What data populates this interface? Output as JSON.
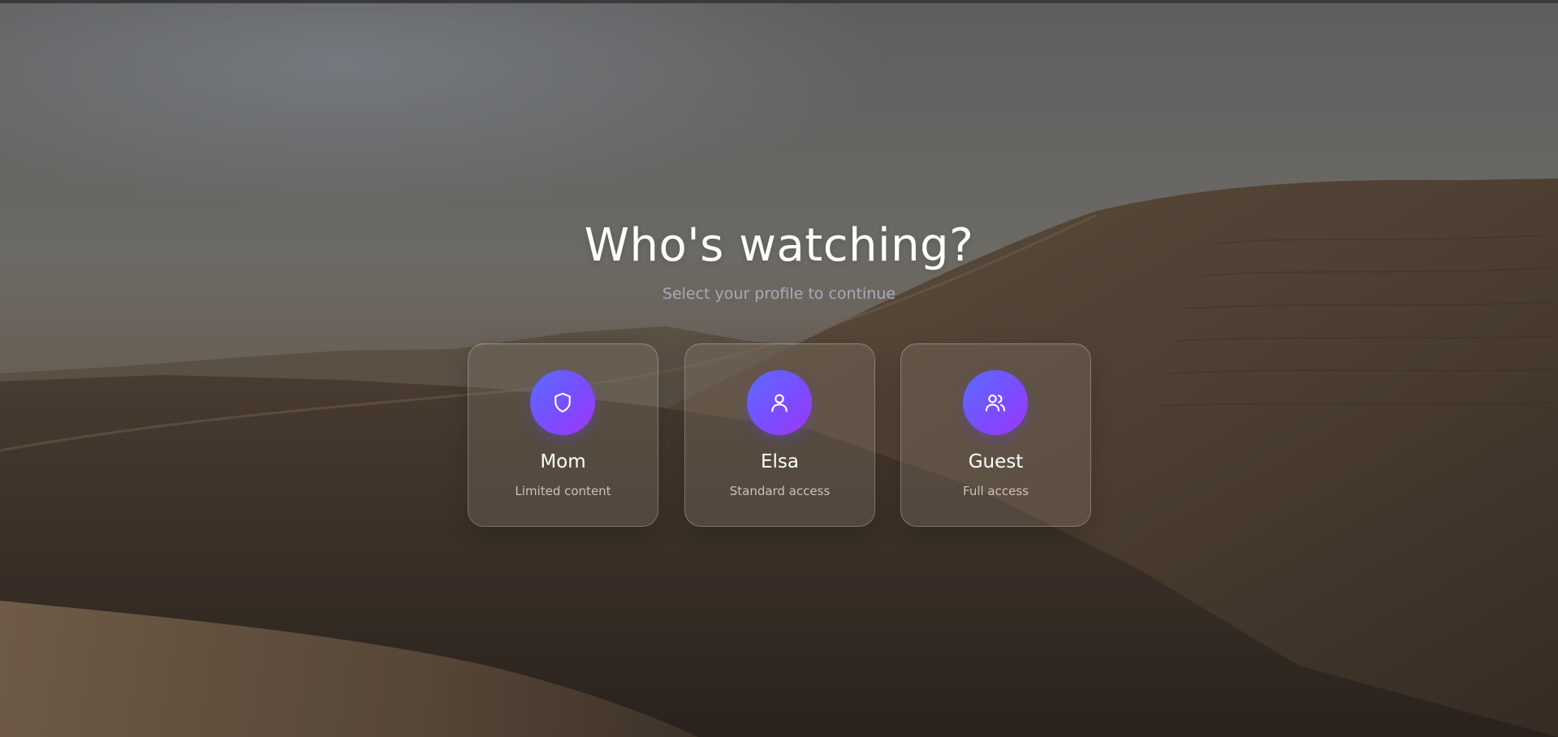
{
  "page": {
    "title": "Who's watching?",
    "subtitle": "Select your profile to continue"
  },
  "profiles": [
    {
      "name": "Mom",
      "description": "Limited content",
      "icon": "shield-icon"
    },
    {
      "name": "Elsa",
      "description": "Standard access",
      "icon": "user-icon"
    },
    {
      "name": "Guest",
      "description": "Full access",
      "icon": "users-icon"
    }
  ],
  "colors": {
    "avatar_gradient_start": "#5b6cff",
    "avatar_gradient_end": "#a236f5",
    "title": "#ffffff",
    "subtitle": "#a9aab8"
  }
}
